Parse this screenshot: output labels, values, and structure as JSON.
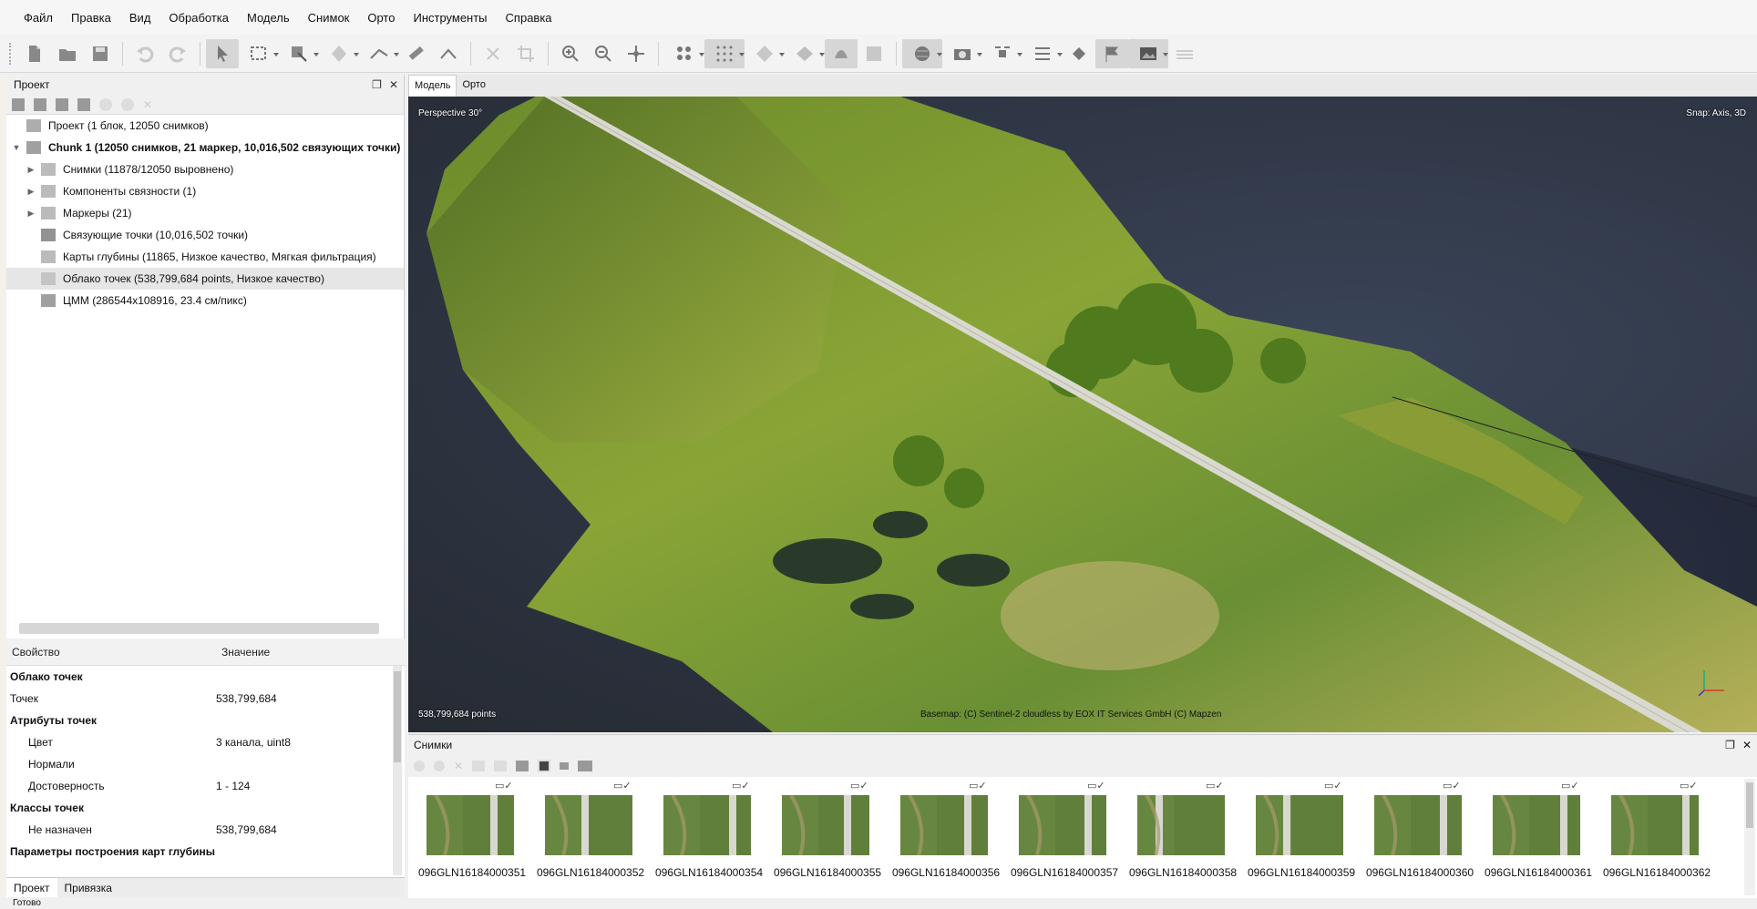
{
  "menu": [
    "Файл",
    "Правка",
    "Вид",
    "Обработка",
    "Модель",
    "Снимок",
    "Орто",
    "Инструменты",
    "Справка"
  ],
  "toolbar_icons": [
    "new-file-icon",
    "open-folder-icon",
    "save-icon",
    "undo-icon",
    "redo-icon",
    "navigate-cursor-icon",
    "rectangle-select-icon",
    "region-select-icon",
    "shape-icon",
    "ruler-icon",
    "measure-icon",
    "delete-icon",
    "crop-icon",
    "zoom-in-icon",
    "zoom-out-icon",
    "move-region-icon",
    "points-icon",
    "dense-cloud-icon",
    "mesh-icon",
    "texture-icon",
    "dem-icon",
    "orthomosaic-icon",
    "globe-icon",
    "camera-icon",
    "drone-icon",
    "list-icon",
    "shapes-icon",
    "flag-icon",
    "image-icon",
    "layers-icon"
  ],
  "project_panel": {
    "title": "Проект",
    "tree": [
      {
        "label": "Проект (1 блок, 12050 снимков)",
        "level": 0,
        "bold": false,
        "arrow": "",
        "icon": "project-icon"
      },
      {
        "label": "Chunk 1 (12050 снимков, 21 маркер, 10,016,502 связующих точки)",
        "level": 1,
        "bold": true,
        "arrow": "▼",
        "icon": "chunk-icon"
      },
      {
        "label": "Снимки (11878/12050 выровнено)",
        "level": 2,
        "bold": false,
        "arrow": "▶",
        "icon": "folder-icon"
      },
      {
        "label": "Компоненты связности (1)",
        "level": 2,
        "bold": false,
        "arrow": "▶",
        "icon": "folder-icon"
      },
      {
        "label": "Маркеры (21)",
        "level": 2,
        "bold": false,
        "arrow": "▶",
        "icon": "folder-icon"
      },
      {
        "label": "Связующие точки (10,016,502 точки)",
        "level": 2,
        "bold": false,
        "arrow": "",
        "icon": "tie-points-icon"
      },
      {
        "label": "Карты глубины (11865, Низкое качество, Мягкая фильтрация)",
        "level": 2,
        "bold": false,
        "arrow": "",
        "icon": "depth-maps-icon"
      },
      {
        "label": "Облако точек (538,799,684 points, Низкое качество)",
        "level": 2,
        "bold": false,
        "arrow": "",
        "icon": "point-cloud-icon",
        "selected": true
      },
      {
        "label": "ЦММ (286544x108916, 23.4 см/пикс)",
        "level": 2,
        "bold": false,
        "arrow": "",
        "icon": "dem-icon"
      }
    ]
  },
  "properties": {
    "col_property": "Свойство",
    "col_value": "Значение",
    "rows": [
      {
        "k": "Облако точек",
        "v": "",
        "group": true
      },
      {
        "k": "Точек",
        "v": "538,799,684",
        "group": false,
        "indent": false
      },
      {
        "k": "Атрибуты точек",
        "v": "",
        "group": true
      },
      {
        "k": "Цвет",
        "v": "3 канала, uint8",
        "group": false,
        "indent": true
      },
      {
        "k": "Нормали",
        "v": "",
        "group": false,
        "indent": true
      },
      {
        "k": "Достоверность",
        "v": "1 - 124",
        "group": false,
        "indent": true
      },
      {
        "k": "Классы точек",
        "v": "",
        "group": true
      },
      {
        "k": "Не назначен",
        "v": "538,799,684",
        "group": false,
        "indent": true
      },
      {
        "k": "Параметры построения карт глубины",
        "v": "",
        "group": true
      }
    ]
  },
  "left_tabs": [
    "Проект",
    "Привязка"
  ],
  "viewport_tabs": [
    "Модель",
    "Орто"
  ],
  "viewport": {
    "perspective": "Perspective 30°",
    "snap": "Snap: Axis, 3D",
    "points": "538,799,684 points",
    "basemap": "Basemap: (C) Sentinel-2 cloudless by EOX IT Services GmbH (C) Mapzen"
  },
  "photos_panel": {
    "title": "Снимки",
    "thumbs": [
      "096GLN16184000351",
      "096GLN16184000352",
      "096GLN16184000354",
      "096GLN16184000355",
      "096GLN16184000356",
      "096GLN16184000357",
      "096GLN16184000358",
      "096GLN16184000359",
      "096GLN16184000360",
      "096GLN16184000361",
      "096GLN16184000362"
    ]
  },
  "status_bar": "Готово"
}
